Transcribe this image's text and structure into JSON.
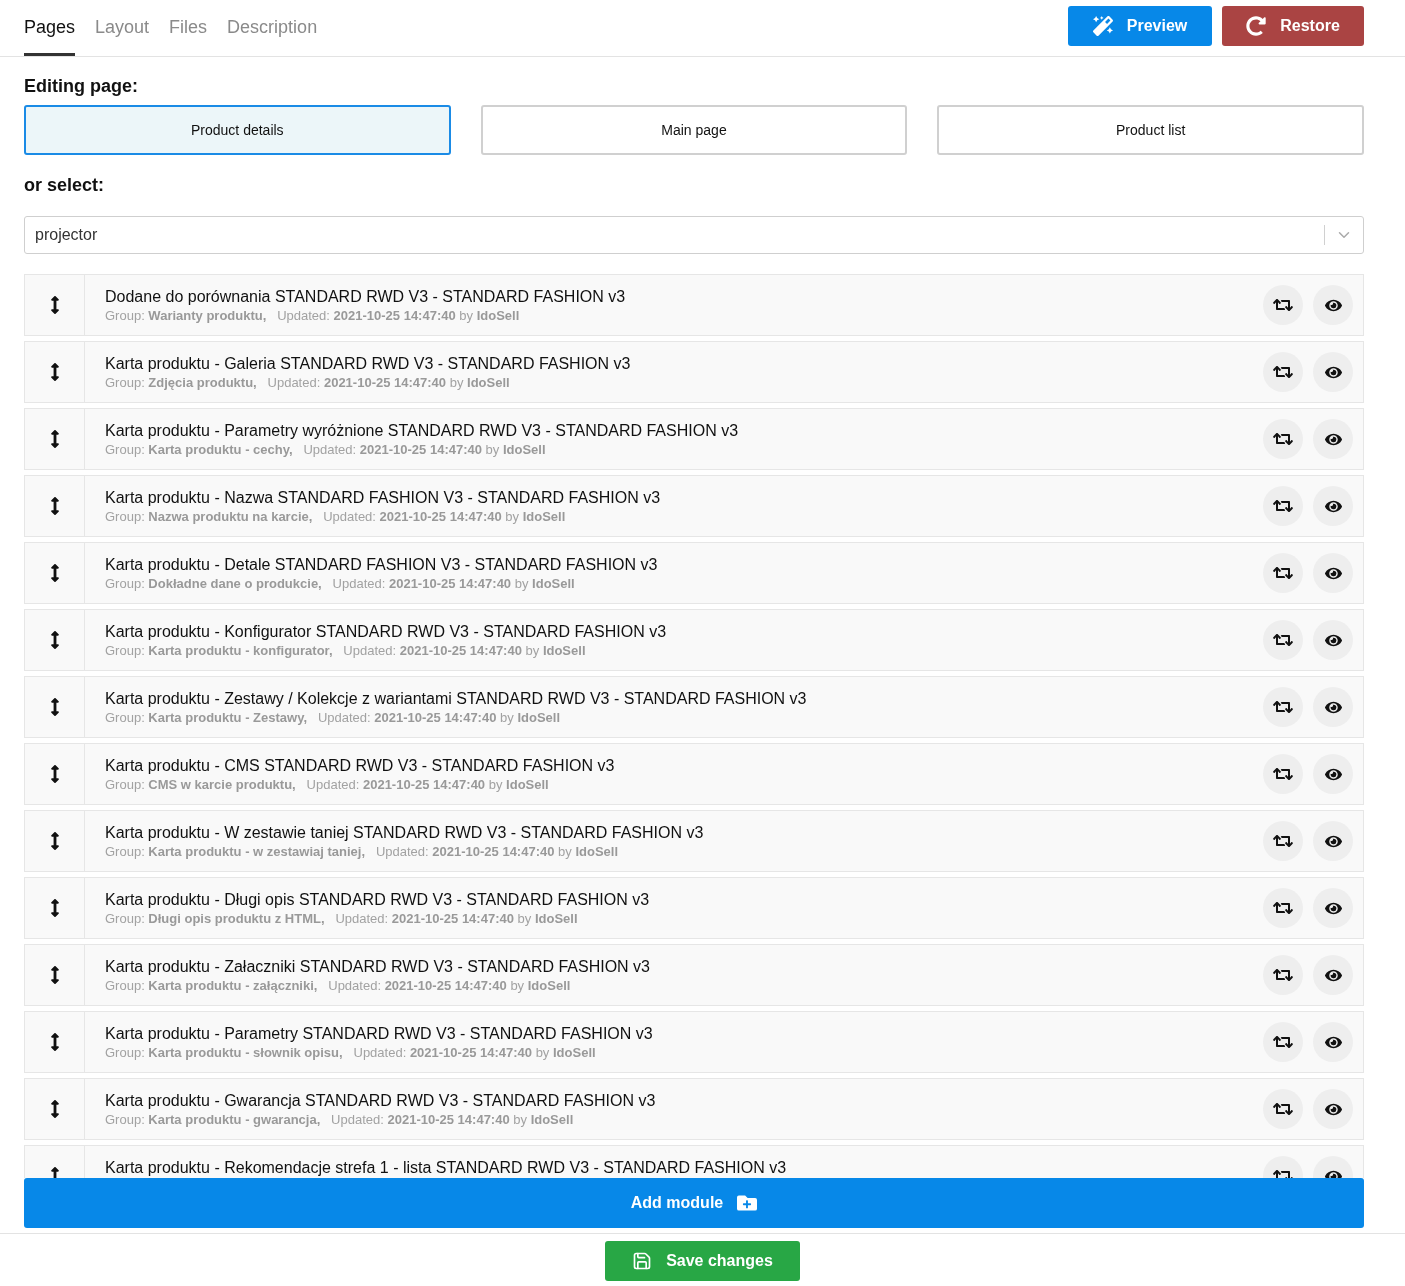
{
  "tabs": [
    {
      "label": "Pages",
      "selected": true
    },
    {
      "label": "Layout",
      "selected": false
    },
    {
      "label": "Files",
      "selected": false
    },
    {
      "label": "Description",
      "selected": false
    }
  ],
  "header_buttons": [
    {
      "kind": "preview",
      "label": "Preview"
    },
    {
      "kind": "restore",
      "label": "Restore"
    }
  ],
  "editing_label": "Editing page:",
  "pages": [
    {
      "label": "Product details",
      "selected": true
    },
    {
      "label": "Main page",
      "selected": false
    },
    {
      "label": "Product list",
      "selected": false
    }
  ],
  "select_label": "or select:",
  "select": {
    "value": "projector"
  },
  "modules": [
    {
      "title": "Dodane do porównania STANDARD RWD V3 - STANDARD FASHION v3",
      "meta": "Group: **Warianty produktu,**   Updated: **2021-10-25 14:47:40** by **IdoSell**"
    },
    {
      "title": "Karta produktu - Galeria STANDARD RWD V3 - STANDARD FASHION v3",
      "meta": "Group: **Zdjęcia produktu,**   Updated: **2021-10-25 14:47:40** by **IdoSell**"
    },
    {
      "title": "Karta produktu - Parametry wyróżnione STANDARD RWD V3 - STANDARD FASHION v3",
      "meta": "Group: **Karta produktu - cechy,**   Updated: **2021-10-25 14:47:40** by **IdoSell**"
    },
    {
      "title": "Karta produktu - Nazwa STANDARD FASHION V3 - STANDARD FASHION v3",
      "meta": "Group: **Nazwa produktu na karcie,**   Updated: **2021-10-25 14:47:40** by **IdoSell**"
    },
    {
      "title": "Karta produktu - Detale STANDARD FASHION V3 - STANDARD FASHION v3",
      "meta": "Group: **Dokładne dane o produkcie,**   Updated: **2021-10-25 14:47:40** by **IdoSell**"
    },
    {
      "title": "Karta produktu - Konfigurator STANDARD RWD V3 - STANDARD FASHION v3",
      "meta": "Group: **Karta produktu - konfigurator,**   Updated: **2021-10-25 14:47:40** by **IdoSell**"
    },
    {
      "title": "Karta produktu - Zestawy / Kolekcje z wariantami STANDARD RWD V3 - STANDARD FASHION v3",
      "meta": "Group: **Karta produktu - Zestawy,**   Updated: **2021-10-25 14:47:40** by **IdoSell**"
    },
    {
      "title": "Karta produktu - CMS STANDARD RWD V3 - STANDARD FASHION v3",
      "meta": "Group: **CMS w karcie produktu,**   Updated: **2021-10-25 14:47:40** by **IdoSell**"
    },
    {
      "title": "Karta produktu - W zestawie taniej STANDARD RWD V3 - STANDARD FASHION v3",
      "meta": "Group: **Karta produktu - w zestawiaj taniej,**   Updated: **2021-10-25 14:47:40** by **IdoSell**"
    },
    {
      "title": "Karta produktu - Długi opis STANDARD RWD V3 - STANDARD FASHION v3",
      "meta": "Group: **Długi opis produktu z HTML,**   Updated: **2021-10-25 14:47:40** by **IdoSell**"
    },
    {
      "title": "Karta produktu - Załaczniki STANDARD RWD V3 - STANDARD FASHION v3",
      "meta": "Group: **Karta produktu - załączniki,**   Updated: **2021-10-25 14:47:40** by **IdoSell**"
    },
    {
      "title": "Karta produktu - Parametry STANDARD RWD V3 - STANDARD FASHION v3",
      "meta": "Group: **Karta produktu - słownik opisu,**   Updated: **2021-10-25 14:47:40** by **IdoSell**"
    },
    {
      "title": "Karta produktu - Gwarancja STANDARD RWD V3 - STANDARD FASHION v3",
      "meta": "Group: **Karta produktu - gwarancja,**   Updated: **2021-10-25 14:47:40** by **IdoSell**"
    },
    {
      "title": "Karta produktu - Rekomendacje strefa 1 - lista STANDARD RWD V3 - STANDARD FASHION v3"
    }
  ],
  "add_module": {
    "label": "Add module"
  },
  "save": {
    "label": "Save changes"
  }
}
